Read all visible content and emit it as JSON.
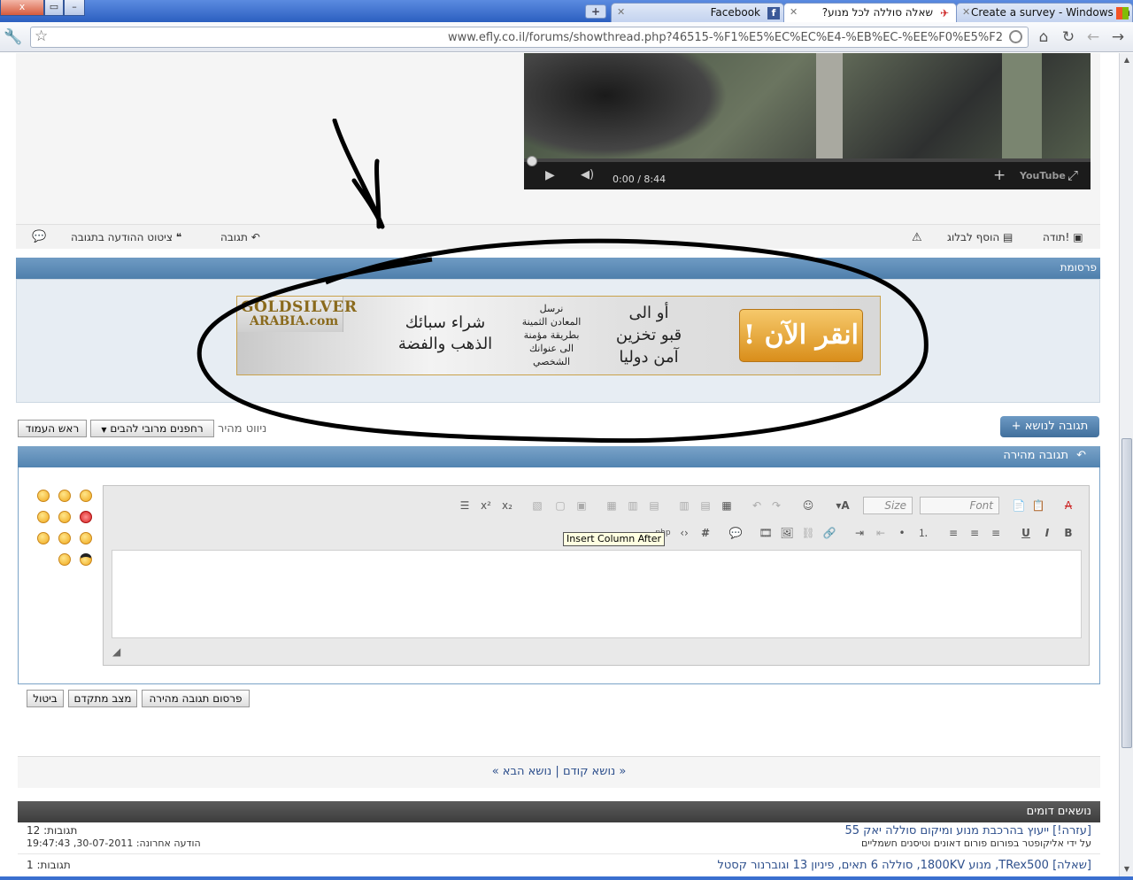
{
  "window": {
    "close": "x",
    "restore": "▭",
    "minimize": "–"
  },
  "tabs": [
    {
      "label": "Create a survey - Windows Sh",
      "active": false
    },
    {
      "label": "שאלה סוללה לכל מנוע?",
      "active": true
    },
    {
      "label": "Facebook",
      "active": false
    }
  ],
  "newtab": "+",
  "address": {
    "url": "www.efly.co.il/forums/showthread.php?46515-%F1%E5%EC%EC%E4-%EB%EC-%EE%F0%E5%F2"
  },
  "video": {
    "time": "0:00 / 8:44",
    "logo": "YouTube"
  },
  "post_actions": {
    "reply": "תגובה",
    "quote": "ציטוט ההודעה בתגובה",
    "thanks": "תודה!",
    "add_blog": "הוסף לבלוג"
  },
  "ad": {
    "header": "פרסומת",
    "logo_line1": "GOLDSILVER",
    "logo_line2": "ARABIA.com",
    "text1_line1": "شراء سبائك",
    "text1_line2": "الذهب والفضة",
    "text2": [
      "نرسل",
      "المعادن الثمينة",
      "بطريقة مؤمنة",
      "الى عنوانك",
      "الشخصي"
    ],
    "text3": [
      "أو الى",
      "قبو تخزين",
      "آمن دوليا"
    ],
    "button": "انقر الآن !"
  },
  "reply_topic": "תגובה לנושא",
  "quick_nav": {
    "label": "ניווט מהיר",
    "select": "רחפנים מרובי להבים",
    "top": "ראש העמוד"
  },
  "quick_reply": {
    "header": "תגובה מהירה"
  },
  "editor": {
    "font_placeholder": "Font",
    "size_placeholder": "Size",
    "tooltip": "Insert Column After"
  },
  "buttons": {
    "post": "פרסום תגובה מהירה",
    "advanced": "מצב מתקדם",
    "cancel": "ביטול"
  },
  "thread_nav": {
    "prev": "« נושא קודם",
    "sep": "|",
    "next": "נושא הבא »"
  },
  "similar": {
    "header": "נושאים דומים",
    "rows": [
      {
        "title": "[עזרה!] ייעוץ בהרכבת מנוע ומיקום סוללה יאק 55",
        "sub": "על ידי אליקופטר בפורום פורום דאונים וטיסנים חשמליים",
        "replies_label": "תגובות:",
        "replies": "12",
        "last_label": "הודעה אחרונה:",
        "last": "30-07-2011, 19:47:43"
      },
      {
        "title": "[שאלה] TRex500, מנוע 1800KV, סוללה 6 תאים, פיניון 13 וגוברנור קסטל",
        "sub": "",
        "replies_label": "תגובות:",
        "replies": "1",
        "last_label": "",
        "last": ""
      }
    ]
  }
}
